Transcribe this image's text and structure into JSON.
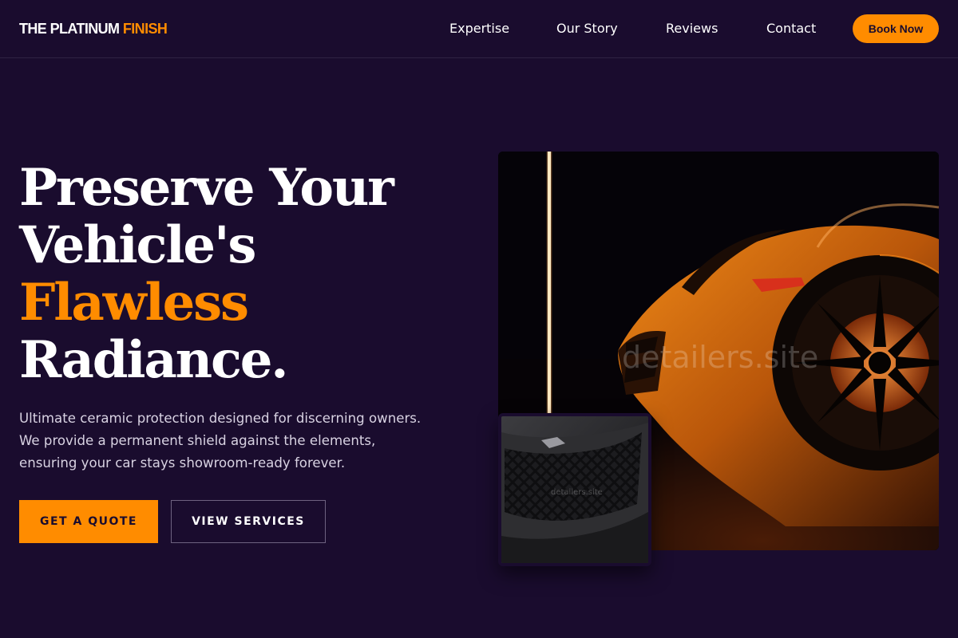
{
  "brand": {
    "name_main": "THE PLATINUM",
    "name_accent": "FINISH"
  },
  "nav": {
    "links": [
      "Expertise",
      "Our Story",
      "Reviews",
      "Contact"
    ],
    "cta": "Book Now"
  },
  "hero": {
    "headline_1": "Preserve Your",
    "headline_2": "Vehicle's",
    "headline_accent": "Flawless",
    "headline_4": "Radiance.",
    "subtitle": "Ultimate ceramic protection designed for discerning owners. We provide a permanent shield against the elements, ensuring your car stays showroom-ready forever.",
    "primary_cta": "GET A QUOTE",
    "secondary_cta": "VIEW SERVICES"
  },
  "images": {
    "main_watermark": "detailers.site",
    "thumb_watermark": "detailers.site"
  },
  "colors": {
    "background": "#1a0c2e",
    "accent": "#ff8c00",
    "text": "#ffffff",
    "muted_text": "#d8d2e2"
  }
}
